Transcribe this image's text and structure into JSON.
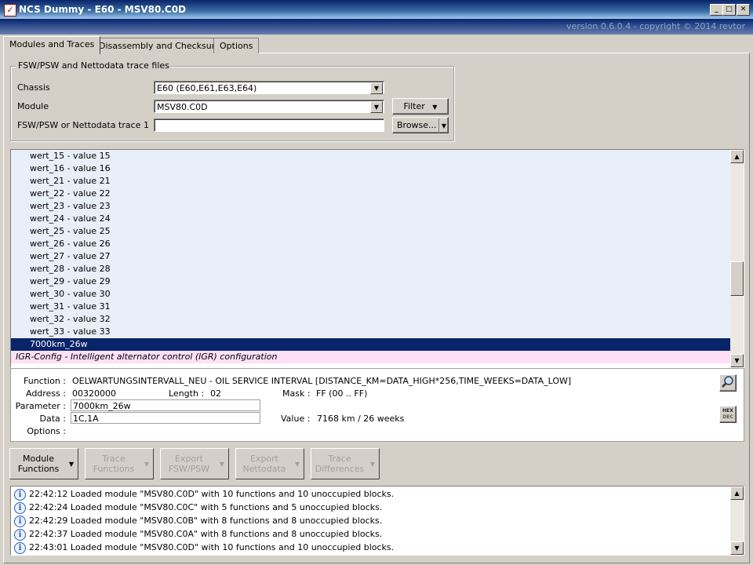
{
  "window": {
    "title": "NCS Dummy - E60 - MSV80.C0D",
    "version": "version 0.6.0.4 - copyright © 2014 revtor"
  },
  "tabs": [
    "Modules and Traces",
    "Disassembly and Checksums",
    "Options"
  ],
  "files": {
    "legend": "FSW/PSW and Nettodata trace files",
    "chassis_label": "Chassis",
    "chassis_value": "E60  (E60,E61,E63,E64)",
    "module_label": "Module",
    "module_value": "MSV80.C0D",
    "trace_label": "FSW/PSW or Nettodata trace 1",
    "trace_value": "",
    "filter_button": "Filter",
    "browse_button": "Browse..."
  },
  "list": {
    "items": [
      "wert_15  -  value 15",
      "wert_16  -  value 16",
      "wert_21  -  value 21",
      "wert_22  -  value 22",
      "wert_23  -  value 23",
      "wert_24  -  value 24",
      "wert_25  -  value 25",
      "wert_26  -  value 26",
      "wert_27  -  value 27",
      "wert_28  -  value 28",
      "wert_29  -  value 29",
      "wert_30  -  value 30",
      "wert_31  -  value 31",
      "wert_32  -  value 32",
      "wert_33  -  value 33"
    ],
    "selected": "7000km_26w",
    "config": "IGR-Config  -  Intelligent alternator control (IGR) configuration"
  },
  "details": {
    "function_label": "Function :",
    "function_value": "OELWARTUNGSINTERVALL_NEU  -  OIL SERVICE INTERVAL [DISTANCE_KM=DATA_HIGH*256,TIME_WEEKS=DATA_LOW]",
    "address_label": "Address :",
    "address_value": "00320000",
    "length_label": "Length :",
    "length_value": "02",
    "mask_label": "Mask :",
    "mask_value": "FF  (00 .. FF)",
    "parameter_label": "Parameter :",
    "parameter_value": "7000km_26w",
    "data_label": "Data :",
    "data_value": "1C,1A",
    "value_label": "Value :",
    "value_value": "7168 km / 26 weeks",
    "options_label": "Options :",
    "hex_top": "HEX",
    "hex_bottom": "DEC"
  },
  "toolbar": [
    {
      "line1": "Module",
      "line2": "Functions",
      "enabled": true
    },
    {
      "line1": "Trace",
      "line2": "Functions",
      "enabled": false
    },
    {
      "line1": "Export",
      "line2": "FSW/PSW",
      "enabled": false
    },
    {
      "line1": "Export",
      "line2": "Nettodata",
      "enabled": false
    },
    {
      "line1": "Trace",
      "line2": "Differences",
      "enabled": false
    }
  ],
  "log": [
    {
      "time": "22:42:12",
      "text": "Loaded module \"MSV80.C0D\" with 10 functions and 10 unoccupied blocks."
    },
    {
      "time": "22:42:24",
      "text": "Loaded module \"MSV80.C0C\" with 5 functions and 5 unoccupied blocks."
    },
    {
      "time": "22:42:29",
      "text": "Loaded module \"MSV80.C0B\" with 8 functions and 8 unoccupied blocks."
    },
    {
      "time": "22:42:37",
      "text": "Loaded module \"MSV80.C0A\" with 8 functions and 8 unoccupied blocks."
    },
    {
      "time": "22:43:01",
      "text": "Loaded module \"MSV80.C0D\" with 10 functions and 10 unoccupied blocks."
    }
  ]
}
